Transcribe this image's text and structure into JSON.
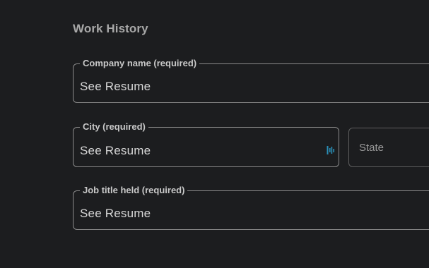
{
  "section": {
    "title": "Work History"
  },
  "fields": {
    "company": {
      "label": "Company name (required)",
      "value": "See Resume"
    },
    "city": {
      "label": "City (required)",
      "value": "See Resume",
      "autofill_icon": "password-manager-icon"
    },
    "state": {
      "placeholder": "State"
    },
    "job_title": {
      "label": "Job title held (required)",
      "value": "See Resume"
    }
  },
  "colors": {
    "background": "#1c1d1f",
    "border": "#8b8b8b",
    "label": "#c8c8c8",
    "value": "#d7d7d7",
    "icon_accent": "#2a8fb8"
  }
}
